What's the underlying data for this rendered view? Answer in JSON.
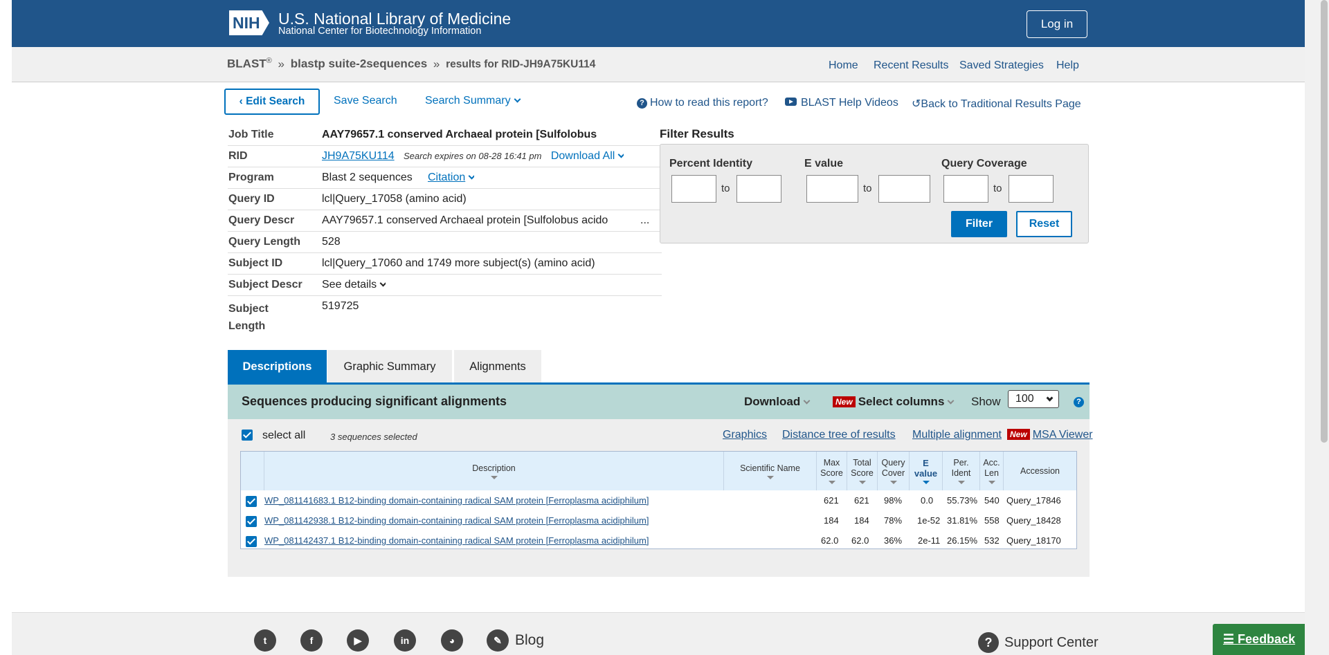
{
  "header": {
    "logo": "NIH",
    "org_name": "U.S. National Library of Medicine",
    "org_sub": "National Center for Biotechnology Information",
    "login": "Log in"
  },
  "breadcrumb": {
    "blast": "BLAST",
    "reg": "®",
    "sep": "»",
    "program": "blastp suite-2sequences",
    "results": "results for RID-JH9A75KU114"
  },
  "topnav": [
    "Home",
    "Recent Results",
    "Saved Strategies",
    "Help"
  ],
  "actions": {
    "edit": "‹ Edit Search",
    "save": "Save Search",
    "summary": "Search Summary",
    "howto": "How to read this report?",
    "videos": "BLAST Help Videos",
    "back": "Back to Traditional Results Page"
  },
  "info": [
    {
      "label": "Job Title",
      "value": "AAY79657.1 conserved Archaeal protein [Sulfolobus"
    },
    {
      "label": "RID",
      "value": "JH9A75KU114",
      "extra": "Search expires on 08-28 16:41 pm",
      "download": "Download All"
    },
    {
      "label": "Program",
      "value": "Blast 2 sequences",
      "citation": "Citation"
    },
    {
      "label": "Query ID",
      "value": "lcl|Query_17058 (amino acid)"
    },
    {
      "label": "Query Descr",
      "value": "AAY79657.1 conserved Archaeal protein [Sulfolobus acido",
      "more": "..."
    },
    {
      "label": "Query Length",
      "value": "528"
    },
    {
      "label": "Subject ID",
      "value": "lcl|Query_17060 and 1749 more subject(s) (amino acid)"
    },
    {
      "label": "Subject Descr",
      "value": "See details"
    },
    {
      "label": "Subject",
      "label2": "Length",
      "value": "519725"
    }
  ],
  "filter": {
    "title": "Filter Results",
    "pi": "Percent Identity",
    "ev": "E value",
    "qc": "Query Coverage",
    "to": "to",
    "filter": "Filter",
    "reset": "Reset"
  },
  "tabs": [
    "Descriptions",
    "Graphic Summary",
    "Alignments"
  ],
  "results": {
    "title": "Sequences producing significant alignments",
    "download": "Download",
    "new": "New",
    "select_cols": "Select columns",
    "show": "Show",
    "show_val": "100",
    "help": "?"
  },
  "panel": {
    "select_all": "select all",
    "selected": "3 sequences selected",
    "links": [
      "Graphics",
      "Distance tree of results",
      "Multiple alignment"
    ],
    "msa": "MSA Viewer"
  },
  "columns": {
    "desc": "Description",
    "sci": "Scientific Name",
    "max1": "Max",
    "max2": "Score",
    "tot1": "Total",
    "tot2": "Score",
    "qc1": "Query",
    "qc2": "Cover",
    "e1": "E",
    "e2": "value",
    "pi1": "Per.",
    "pi2": "Ident",
    "acc1": "Acc.",
    "acc2": "Len",
    "accn": "Accession"
  },
  "rows": [
    {
      "desc": "WP_081141683.1 B12-binding domain-containing radical SAM protein [Ferroplasma acidiphilum]",
      "max": "621",
      "total": "621",
      "qc": "98%",
      "e": "0.0",
      "pi": "55.73%",
      "len": "540",
      "acc": "Query_17846"
    },
    {
      "desc": "WP_081142938.1 B12-binding domain-containing radical SAM protein [Ferroplasma acidiphilum]",
      "max": "184",
      "total": "184",
      "qc": "78%",
      "e": "1e-52",
      "pi": "31.81%",
      "len": "558",
      "acc": "Query_18428"
    },
    {
      "desc": "WP_081142437.1 B12-binding domain-containing radical SAM protein [Ferroplasma acidiphilum]",
      "max": "62.0",
      "total": "62.0",
      "qc": "36%",
      "e": "2e-11",
      "pi": "26.15%",
      "len": "532",
      "acc": "Query_18170"
    }
  ],
  "footer": {
    "blog": "Blog",
    "support": "Support Center",
    "feedback": "Feedback",
    "support_icon": "?"
  },
  "social_icons": [
    "twitter-icon",
    "facebook-icon",
    "youtube-icon",
    "linkedin-icon",
    "github-icon",
    "blog-icon"
  ],
  "colors": {
    "header": "#20558a",
    "accent": "#0071bc",
    "results_bar": "#b8d8d5",
    "feedback": "#2e8540"
  }
}
